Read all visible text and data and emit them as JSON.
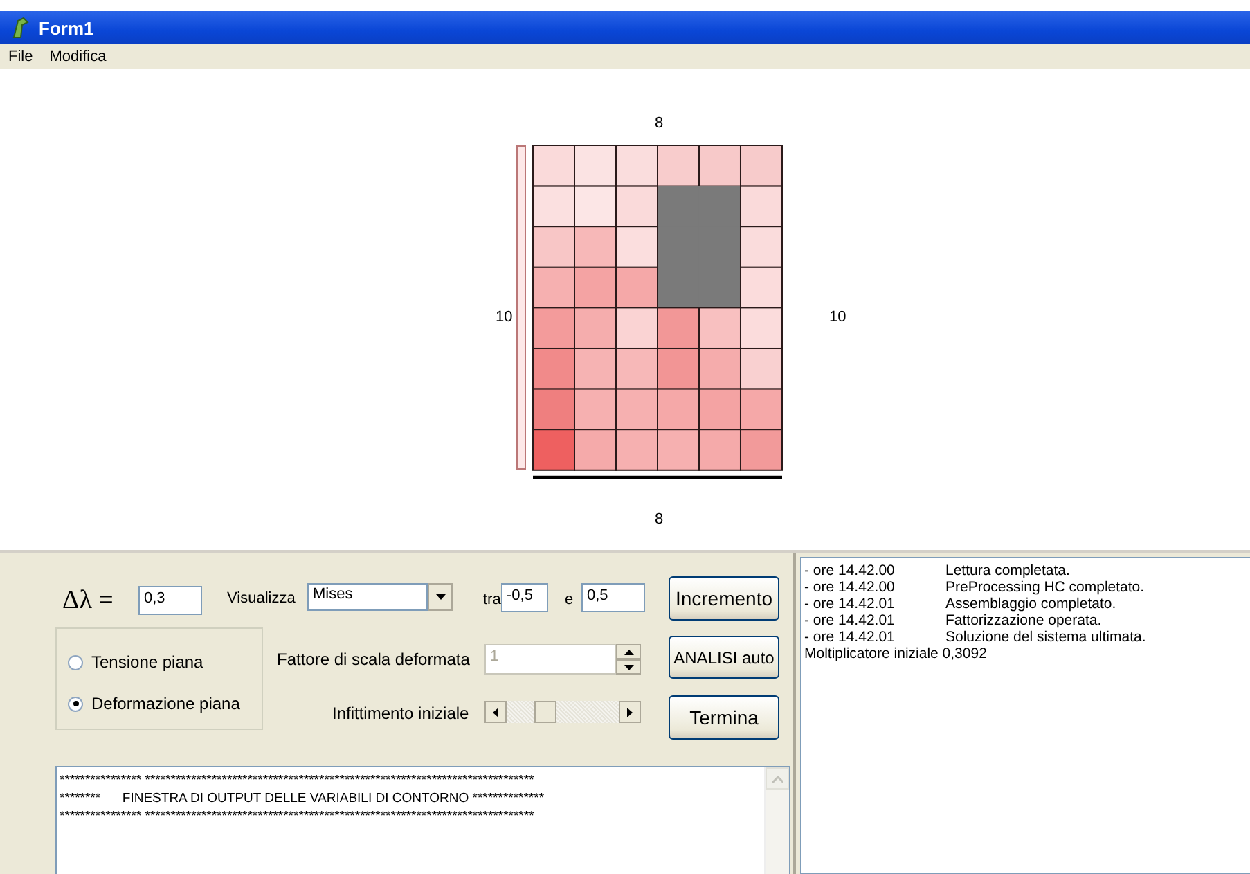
{
  "window": {
    "title": "Form1"
  },
  "menu": [
    {
      "label": "File"
    },
    {
      "label": "Modifica"
    }
  ],
  "mesh": {
    "top_label": "8",
    "left_label": "10",
    "right_label": "10",
    "bottom_label": "8",
    "rows": [
      {
        "cells": [
          {
            "kind": "element",
            "color": "#fadada"
          },
          {
            "kind": "element",
            "color": "#fbe3e3"
          },
          {
            "kind": "element",
            "color": "#fadddd"
          },
          {
            "kind": "element",
            "color": "#f8cccc"
          },
          {
            "kind": "element",
            "color": "#f7c9c9"
          },
          {
            "kind": "element",
            "color": "#f7cbcb"
          }
        ]
      },
      {
        "cells": [
          {
            "kind": "element",
            "color": "#fbe0e0"
          },
          {
            "kind": "element",
            "color": "#fce6e6"
          },
          {
            "kind": "element",
            "color": "#fadada"
          },
          {
            "kind": "void",
            "color": "#7a7a7a"
          },
          {
            "kind": "void",
            "color": "#7a7a7a"
          },
          {
            "kind": "element",
            "color": "#fadada"
          }
        ]
      },
      {
        "cells": [
          {
            "kind": "element",
            "color": "#f8c6c6"
          },
          {
            "kind": "element",
            "color": "#f7b8b8"
          },
          {
            "kind": "element",
            "color": "#fbdede"
          },
          {
            "kind": "void",
            "color": "#7a7a7a"
          },
          {
            "kind": "void",
            "color": "#7a7a7a"
          },
          {
            "kind": "element",
            "color": "#fadcdc"
          }
        ]
      },
      {
        "cells": [
          {
            "kind": "element",
            "color": "#f6b0b0"
          },
          {
            "kind": "element",
            "color": "#f4a3a3"
          },
          {
            "kind": "element",
            "color": "#f5a8a8"
          },
          {
            "kind": "void",
            "color": "#7a7a7a"
          },
          {
            "kind": "void",
            "color": "#7a7a7a"
          },
          {
            "kind": "element",
            "color": "#fbdcdc"
          }
        ]
      },
      {
        "cells": [
          {
            "kind": "element",
            "color": "#f39b9b"
          },
          {
            "kind": "element",
            "color": "#f5adad"
          },
          {
            "kind": "element",
            "color": "#fad3d3"
          },
          {
            "kind": "element",
            "color": "#f29797"
          },
          {
            "kind": "element",
            "color": "#f8c0c0"
          },
          {
            "kind": "element",
            "color": "#fbdcdc"
          }
        ]
      },
      {
        "cells": [
          {
            "kind": "element",
            "color": "#f18a8a"
          },
          {
            "kind": "element",
            "color": "#f6b3b3"
          },
          {
            "kind": "element",
            "color": "#f7b8b8"
          },
          {
            "kind": "element",
            "color": "#f29595"
          },
          {
            "kind": "element",
            "color": "#f5acac"
          },
          {
            "kind": "element",
            "color": "#f9d0d0"
          }
        ]
      },
      {
        "cells": [
          {
            "kind": "element",
            "color": "#ef7f7f"
          },
          {
            "kind": "element",
            "color": "#f6b0b0"
          },
          {
            "kind": "element",
            "color": "#f6b0b0"
          },
          {
            "kind": "element",
            "color": "#f5a8a8"
          },
          {
            "kind": "element",
            "color": "#f4a3a3"
          },
          {
            "kind": "element",
            "color": "#f5a8a8"
          }
        ]
      },
      {
        "cells": [
          {
            "kind": "element",
            "color": "#ee6060"
          },
          {
            "kind": "element",
            "color": "#f5aaaa"
          },
          {
            "kind": "element",
            "color": "#f6b0b0"
          },
          {
            "kind": "element",
            "color": "#f6b0b0"
          },
          {
            "kind": "element",
            "color": "#f5aaaa"
          },
          {
            "kind": "element",
            "color": "#f29a9a"
          }
        ]
      }
    ]
  },
  "controls": {
    "delta_label": "Δλ =",
    "delta_value": "0,3",
    "view_label": "Visualizza",
    "view_value": "Mises",
    "from_label": "tra",
    "from_value": "-0,5",
    "to_label": "e",
    "to_value": "0,5",
    "scale_label": "Fattore di scala deformata",
    "scale_value": "1",
    "scale_disabled": true,
    "refine_label": "Infittimento iniziale"
  },
  "plane_mode": [
    {
      "label": "Tensione piana",
      "selected": false
    },
    {
      "label": "Deformazione piana",
      "selected": true
    }
  ],
  "buttons": [
    {
      "label": "Incremento"
    },
    {
      "label": "ANALISI auto"
    },
    {
      "label": "Termina"
    }
  ],
  "output": {
    "lines": [
      "**************** ****************************************************************************",
      "********      FINESTRA DI OUTPUT DELLE VARIABILI DI CONTORNO **************",
      "**************** ****************************************************************************"
    ]
  },
  "log": {
    "entries": [
      {
        "time": "- ore 14.42.00",
        "message": "Lettura completata."
      },
      {
        "time": "- ore 14.42.00",
        "message": "PreProcessing HC completato."
      },
      {
        "time": "- ore 14.42.01",
        "message": "Assemblaggio completato."
      },
      {
        "time": "- ore 14.42.01",
        "message": "Fattorizzazione operata."
      },
      {
        "time": "- ore 14.42.01",
        "message": "Soluzione del sistema ultimata."
      }
    ],
    "footer": "Moltiplicatore iniziale 0,3092"
  }
}
